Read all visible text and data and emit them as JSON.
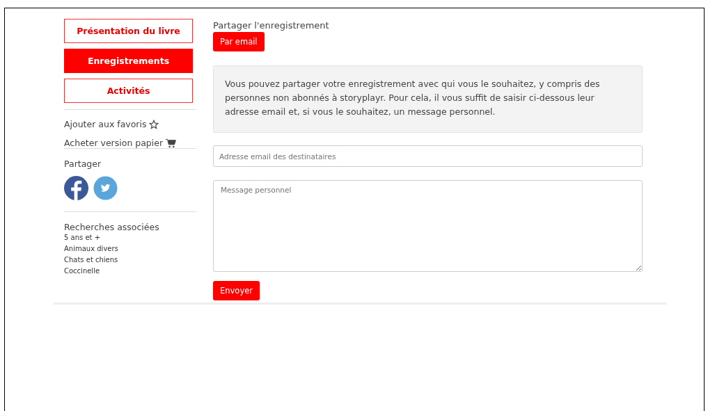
{
  "sidebar": {
    "nav": [
      {
        "label": "Présentation du livre",
        "selected": false
      },
      {
        "label": "Enregistrements",
        "selected": true
      },
      {
        "label": "Activités",
        "selected": false
      }
    ],
    "actions": [
      {
        "label": "Ajouter aux favoris",
        "kind": "favorite"
      },
      {
        "label": "Acheter version papier",
        "kind": "cart"
      }
    ],
    "share": {
      "title": "Partager",
      "networks": [
        {
          "kind": "facebook"
        },
        {
          "kind": "twitter"
        }
      ]
    },
    "related": {
      "title": "Recherches associées",
      "items": [
        "5 ans et +",
        "Animaux divers",
        "Chats et chiens",
        "Coccinelle"
      ]
    }
  },
  "main": {
    "title": "Partager l'enregistrement",
    "method_button": "Par email",
    "info": "Vous pouvez partager votre enregistrement avec qui vous le souhaitez, y compris des personnes non abonnés à storyplayr. Pour cela, il vous suffit de saisir ci-dessous leur adresse email et, si vous le souhaitez, un message personnel.",
    "email_field": {
      "placeholder": "Adresse email des destinataires"
    },
    "message_field": {
      "placeholder": "Message personnel"
    },
    "submit": "Envoyer"
  }
}
